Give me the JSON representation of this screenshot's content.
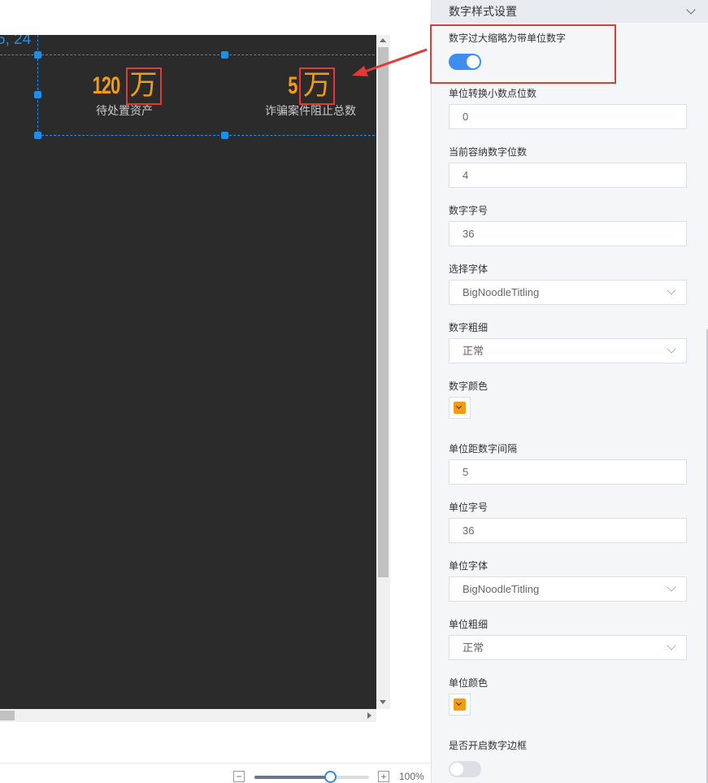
{
  "canvas": {
    "coord_label": "5, 24",
    "kpis": [
      {
        "number": "120",
        "unit": "万",
        "label": "待处置资产"
      },
      {
        "number": "5",
        "unit": "万",
        "label": "诈骗案件阻止总数"
      }
    ],
    "zoom": {
      "minus": "−",
      "plus": "+",
      "value_text": "100%",
      "level_fraction": 0.66
    }
  },
  "panel": {
    "header_title": "数字样式设置",
    "abbreviate": {
      "label": "数字过大缩略为带单位数字",
      "enabled": true
    },
    "decimal_places": {
      "label": "单位转换小数点位数",
      "value": "0"
    },
    "digit_capacity": {
      "label": "当前容纳数字位数",
      "value": "4"
    },
    "number_font_size": {
      "label": "数字字号",
      "value": "36"
    },
    "font_family": {
      "label": "选择字体",
      "value": "BigNoodleTitling"
    },
    "number_weight": {
      "label": "数字粗细",
      "value": "正常"
    },
    "number_color": {
      "label": "数字颜色",
      "color": "#f39c12"
    },
    "unit_spacing": {
      "label": "单位距数字间隔",
      "value": "5"
    },
    "unit_font_size": {
      "label": "单位字号",
      "value": "36"
    },
    "unit_font_family": {
      "label": "单位字体",
      "value": "BigNoodleTitling"
    },
    "unit_weight": {
      "label": "单位粗细",
      "value": "正常"
    },
    "unit_color": {
      "label": "单位颜色",
      "color": "#f39c12"
    },
    "number_border": {
      "label": "是否开启数字边框",
      "enabled": false
    }
  },
  "colors": {
    "accent": "#1e8fe6",
    "highlight": "#e53935",
    "number": "#f39c12",
    "stage_bg": "#2b2b2b"
  }
}
